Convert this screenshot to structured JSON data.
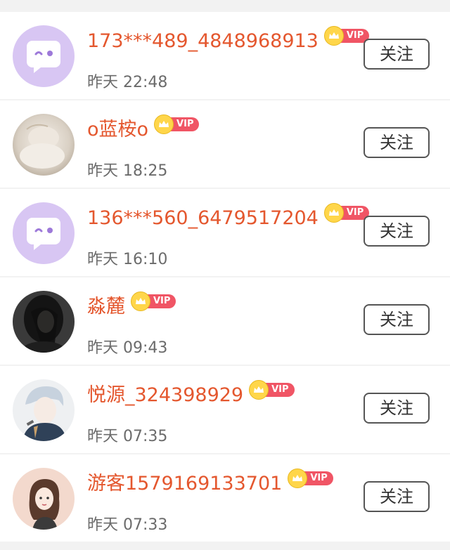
{
  "users": [
    {
      "name": "173***489_4848968913",
      "vip": "VIP",
      "time": "昨天 22:48",
      "follow": "关注",
      "avatar": "default-chat-bubble-avatar"
    },
    {
      "name": "o蓝桉o",
      "vip": "VIP",
      "time": "昨天 18:25",
      "follow": "关注",
      "avatar": "photo-avatar"
    },
    {
      "name": "136***560_6479517204",
      "vip": "VIP",
      "time": "昨天 16:10",
      "follow": "关注",
      "avatar": "default-chat-bubble-avatar"
    },
    {
      "name": "淼麓",
      "vip": "VIP",
      "time": "昨天 09:43",
      "follow": "关注",
      "avatar": "photo-avatar"
    },
    {
      "name": "悦源_324398929",
      "vip": "VIP",
      "time": "昨天 07:35",
      "follow": "关注",
      "avatar": "illustration-avatar"
    },
    {
      "name": "游客1579169133701",
      "vip": "VIP",
      "time": "昨天 07:33",
      "follow": "关注",
      "avatar": "illustration-avatar"
    }
  ],
  "colors": {
    "name": "#e4572e",
    "vip_badge": "#f05565",
    "crown": "#ffd64a",
    "default_avatar_bg": "#d8c6f3",
    "default_avatar_fg": "#9d79d9"
  }
}
